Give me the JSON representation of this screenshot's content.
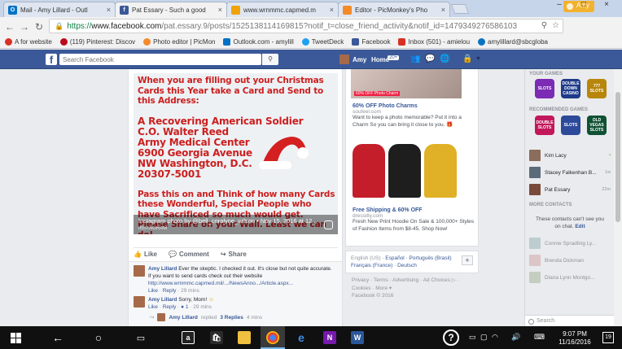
{
  "browser": {
    "tabs": [
      {
        "title": "Mail - Amy Lillard - Outl",
        "fav_color": "#0072c6",
        "fav_glyph": "O"
      },
      {
        "title": "Pat Essary - Such a good",
        "fav_color": "#3b5998",
        "fav_glyph": "f"
      },
      {
        "title": "www.wrnmmc.capmed.m",
        "fav_color": "#f0a30a",
        "fav_glyph": ""
      },
      {
        "title": "Editor - PicMonkey's Pho",
        "fav_color": "#f58a2b",
        "fav_glyph": ""
      }
    ],
    "user_badge": "Amy",
    "url_scheme": "https://",
    "url_host": "www.facebook.com",
    "url_path": "/pat.essary.9/posts/1525138114169815?notif_t=close_friend_activity&notif_id=1479349276586103",
    "bookmarks": [
      {
        "label": "A for website",
        "color": "#d93025"
      },
      {
        "label": "(119) Pinterest: Discov",
        "color": "#bd081c"
      },
      {
        "label": "Photo editor | PicMon",
        "color": "#f58a2b"
      },
      {
        "label": "Outlook.com - amylill",
        "color": "#0072c6"
      },
      {
        "label": "TweetDeck",
        "color": "#1da1f2"
      },
      {
        "label": "Facebook",
        "color": "#3b5998"
      },
      {
        "label": "Inbox (501) - amielou",
        "color": "#d93025"
      },
      {
        "label": "amylillard@sbcgloba",
        "color": "#0a73c1"
      }
    ]
  },
  "facebook": {
    "search_placeholder": "Search Facebook",
    "user_name": "Amy",
    "home_label": "Home",
    "home_count": "20+"
  },
  "post": {
    "card_intro": "When you are filling out your Christmas Cards this Year take a Card and Send to this Address:",
    "card_address": [
      "A Recovering American Soldier",
      "C.O. Walter Reed",
      "Army Medical Center",
      "6900 Georgia Avenue",
      "NW Washington, D.C.",
      "20307-5001"
    ],
    "card_outro": "Pass this on and Think of how many Cards these Wonderful, Special People who have Sacrificed so much would get. Please Share on your Wall. Least we can do!",
    "caption": "Instagram photo by @bell_coralyne_wilson • Nov 15, 2016 at 12...",
    "caption_source": "INSTAGRAM",
    "actions": {
      "like": "Like",
      "comment": "Comment",
      "share": "Share"
    },
    "comments": [
      {
        "name": "Amy Lillard",
        "text": "Ever the skeptic. I checked it out. It's close but not quite accurate. If you want to send cards check out their website",
        "link": "http://www.wrnmmc.capmed.mil/.../NewsAnno.../Article.aspx...",
        "like": "Like",
        "reply": "Reply",
        "time": "29 mins"
      },
      {
        "name": "Amy Lillard",
        "text": "Sorry, Mom!",
        "like": "Like",
        "reply": "Reply",
        "likes": "1",
        "time": "29 mins"
      }
    ],
    "reply_summary": {
      "name": "Amy Lillard",
      "verb": "replied",
      "count": "3 Replies",
      "time": "4 mins"
    }
  },
  "ads": [
    {
      "label": "60% OFF Photo Charm",
      "title": "60% OFF Photo Charms",
      "domain": "soufeel.com",
      "desc": "Want to keep a photo memorable? Put it into a Charm So you can bring it close to you."
    },
    {
      "title": "Free Shipping & 60% OFF",
      "domain": "dressitly.com",
      "desc": "Fresh New Print Hoodie On Sale & 100,000+ Styles of Fashion Items from $8-45. Shop Now!"
    }
  ],
  "languages": {
    "current": "English (US)",
    "others": [
      "Español",
      "Português (Brasil)",
      "Français (France)",
      "Deutsch"
    ],
    "plus": "+"
  },
  "footer": {
    "links": [
      "Privacy",
      "Terms",
      "Advertising",
      "Ad Choices",
      "Cookies",
      "More"
    ],
    "copyright": "Facebook © 2016"
  },
  "chat": {
    "your_games": "YOUR GAMES",
    "recommended_games": "RECOMMENDED GAMES",
    "games": [
      {
        "name": "SLOTS",
        "color": "#7b2bb4"
      },
      {
        "name": "DOUBLE DOWN CASINO",
        "color": "#1e3a8a"
      },
      {
        "name": "777 SLOTS",
        "color": "#b8860b"
      },
      {
        "name": "DOUBLE SLOTS",
        "color": "#c2185b"
      },
      {
        "name": "SLOTS",
        "color": "#2d4a9a"
      },
      {
        "name": "OLD VEGAS SLOTS",
        "color": "#0f5132"
      }
    ],
    "contacts": [
      {
        "name": "Kim Lacy",
        "status": "•",
        "color": "#8a6d5a"
      },
      {
        "name": "Stacey Falkenhan B...",
        "status": "1w",
        "color": "#5c6b7a"
      },
      {
        "name": "Pat Essary",
        "status": "22m",
        "color": "#7a4a3a"
      }
    ],
    "more_contacts": "MORE CONTACTS",
    "note": "These contacts can't see you on chat.",
    "note_link": "Edit",
    "offline": [
      {
        "name": "Connie Spradling Ly...",
        "color": "#8aa"
      },
      {
        "name": "Brenda Dickman",
        "color": "#c99"
      },
      {
        "name": "Diana Lynn Montgo...",
        "color": "#9a8"
      }
    ],
    "search": "Search"
  },
  "taskbar": {
    "time": "9:07 PM",
    "date": "11/16/2016",
    "notifications": "19"
  }
}
